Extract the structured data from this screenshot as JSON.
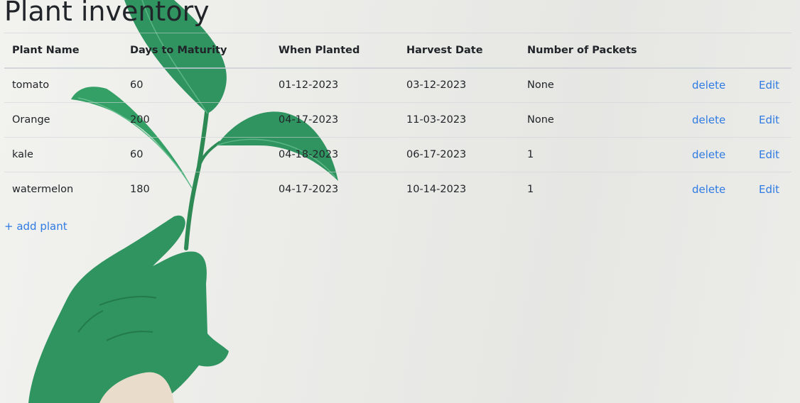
{
  "page": {
    "title": "Plant inventory"
  },
  "table": {
    "headers": [
      "Plant Name",
      "Days to Maturity",
      "When Planted",
      "Harvest Date",
      "Number of Packets"
    ],
    "rows": [
      {
        "name": "tomato",
        "days": "60",
        "planted": "01-12-2023",
        "harvest": "03-12-2023",
        "packets": "None",
        "delete_label": "delete",
        "edit_label": "Edit"
      },
      {
        "name": "Orange",
        "days": "200",
        "planted": "04-17-2023",
        "harvest": "11-03-2023",
        "packets": "None",
        "delete_label": "delete",
        "edit_label": "Edit"
      },
      {
        "name": "kale",
        "days": "60",
        "planted": "04-18-2023",
        "harvest": "06-17-2023",
        "packets": "1",
        "delete_label": "delete",
        "edit_label": "Edit"
      },
      {
        "name": "watermelon",
        "days": "180",
        "planted": "04-17-2023",
        "harvest": "10-14-2023",
        "packets": "1",
        "delete_label": "delete",
        "edit_label": "Edit"
      }
    ]
  },
  "actions": {
    "add_plant_label": "+ add plant"
  },
  "colors": {
    "link": "#2f7be3",
    "leaf_green": "#2f9460",
    "background": "#ebebe8"
  },
  "background_image": {
    "icon": "green-hand-holding-plant-sprig"
  }
}
